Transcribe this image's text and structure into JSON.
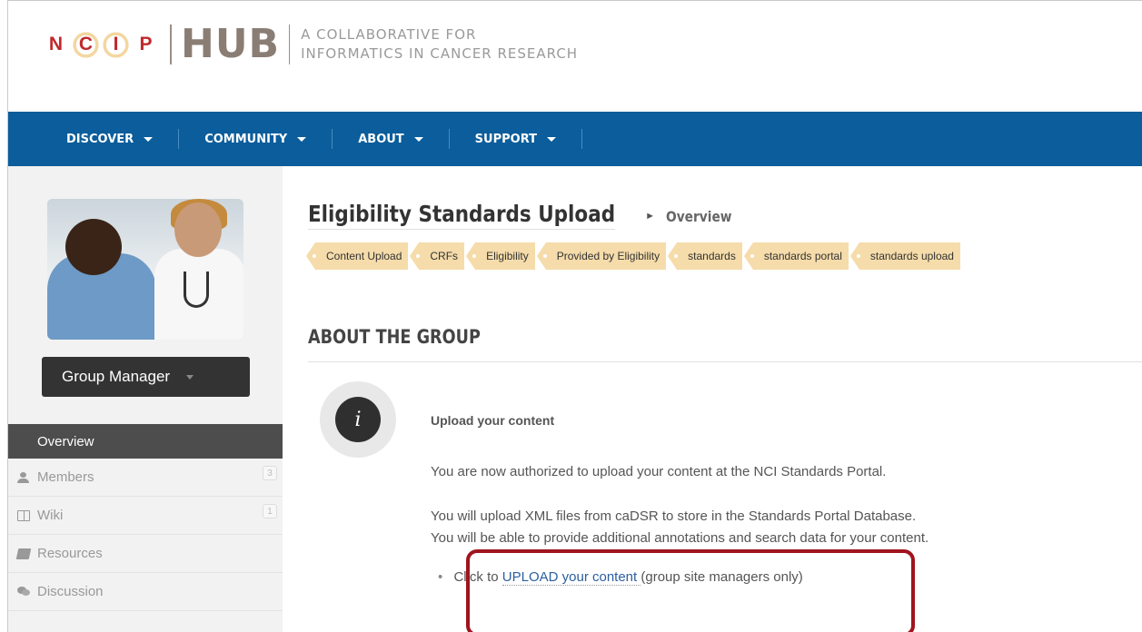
{
  "header": {
    "logo_letters": [
      "N",
      "C",
      "I",
      "P"
    ],
    "hub_text": "HUB",
    "tagline_line1": "A COLLABORATIVE FOR",
    "tagline_line2": "INFORMATICS IN CANCER RESEARCH"
  },
  "nav": {
    "items": [
      {
        "label": "DISCOVER"
      },
      {
        "label": "COMMUNITY"
      },
      {
        "label": "ABOUT"
      },
      {
        "label": "SUPPORT"
      }
    ]
  },
  "sidebar": {
    "group_manager_label": "Group Manager",
    "menu": [
      {
        "label": "Overview",
        "icon": "grid-icon",
        "active": true
      },
      {
        "label": "Members",
        "icon": "user-icon",
        "count": "3"
      },
      {
        "label": "Wiki",
        "icon": "book-icon",
        "count": "1"
      },
      {
        "label": "Resources",
        "icon": "resources-icon"
      },
      {
        "label": "Discussion",
        "icon": "chat-icon"
      }
    ]
  },
  "main": {
    "title": "Eligibility Standards Upload",
    "breadcrumb_arrow": "►",
    "breadcrumb": "Overview",
    "tags": [
      "Content Upload",
      "CRFs",
      "Eligibility",
      "Provided by Eligibility",
      "standards",
      "standards portal",
      "standards upload"
    ],
    "section_title": "ABOUT THE GROUP",
    "info_icon_glyph": "i",
    "upload_heading": "Upload your content",
    "paragraph1": "You are now authorized to upload your content at the NCI Standards Portal.",
    "paragraph2_line1": "You will upload XML files from caDSR to store in the Standards Portal Database.",
    "paragraph2_line2": "You will be able to provide additional annotations and search data for your content.",
    "bullet_prefix": "Click to",
    "bullet_link": "UPLOAD your content",
    "bullet_suffix": "(group site managers only)"
  },
  "colors": {
    "nav_bg": "#0b5d9b",
    "tag_bg": "#f5dcaa",
    "highlight_border": "#a0141e",
    "active_menu_bg": "#4d4d4d"
  }
}
